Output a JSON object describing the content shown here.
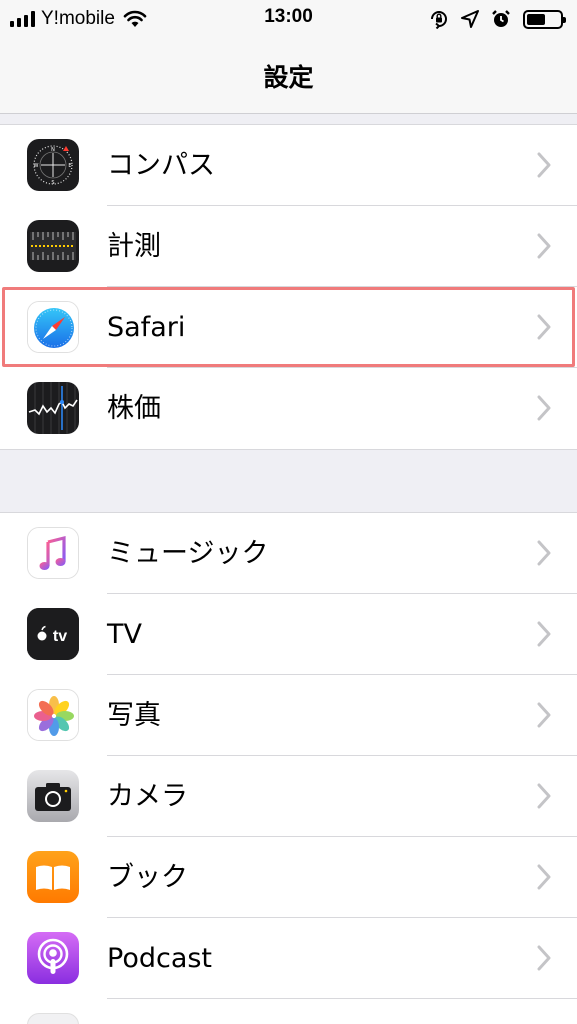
{
  "status_bar": {
    "carrier": "Y!mobile",
    "time": "13:00",
    "battery_level": 0.55,
    "icons": [
      "signal-bars-icon",
      "wifi-icon",
      "orientation-lock-icon",
      "location-arrow-icon",
      "alarm-icon",
      "battery-icon"
    ]
  },
  "nav": {
    "title": "設定"
  },
  "group1": {
    "items": [
      {
        "label": "コンパス",
        "icon": "compass-icon"
      },
      {
        "label": "計測",
        "icon": "measure-icon"
      },
      {
        "label": "Safari",
        "icon": "safari-icon"
      },
      {
        "label": "株価",
        "icon": "stocks-icon"
      }
    ]
  },
  "group2": {
    "items": [
      {
        "label": "ミュージック",
        "icon": "music-icon"
      },
      {
        "label": "TV",
        "icon": "tv-icon",
        "icon_text": "tv"
      },
      {
        "label": "写真",
        "icon": "photos-icon"
      },
      {
        "label": "カメラ",
        "icon": "camera-icon"
      },
      {
        "label": "ブック",
        "icon": "books-icon"
      },
      {
        "label": "Podcast",
        "icon": "podcast-icon"
      }
    ]
  },
  "highlight": {
    "target": "Safari",
    "color": "#f07b7b"
  }
}
